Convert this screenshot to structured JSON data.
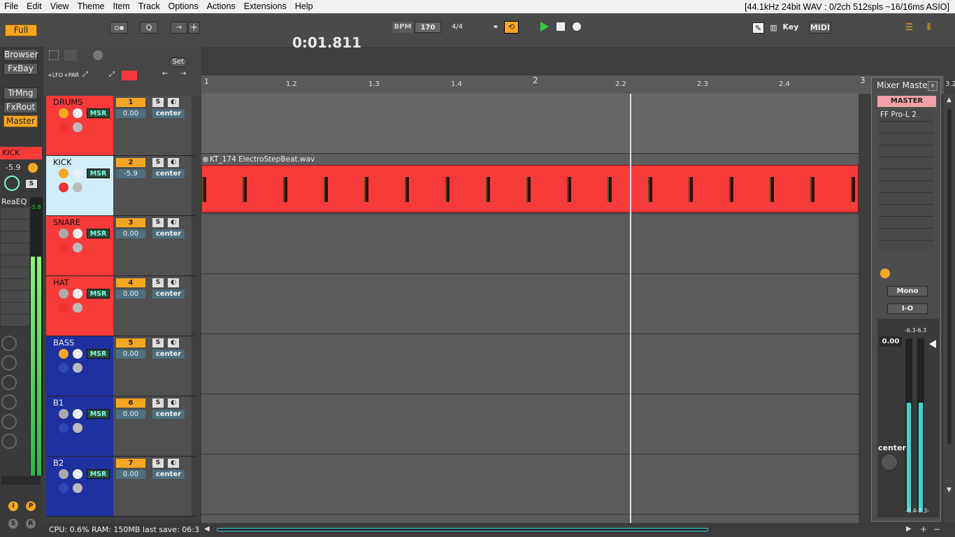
{
  "menu": {
    "items": [
      "File",
      "Edit",
      "View",
      "Theme",
      "Item",
      "Track",
      "Options",
      "Actions",
      "Extensions",
      "Help"
    ],
    "status": "[44.1kHz 24bit WAV : 0/2ch 512spls ~16/16ms ASIO]"
  },
  "toolbar": {
    "full": "Full",
    "quantize": "Q",
    "time": "0:01.811",
    "bpm_label": "BPM",
    "bpm": "170",
    "timesig": "4/4",
    "key": "Key",
    "midi": "MIDI",
    "set": "Set",
    "lfo": "+LFO",
    "par": "+PAR"
  },
  "left": {
    "buttons": [
      "Browser",
      "FxBay",
      "TrMng",
      "FxRout",
      "Master"
    ],
    "selected_track": "KICK",
    "selected_vol": "-5.9",
    "s": "S",
    "fx": "ReaEQ",
    "meter_peak": "-5.8",
    "i": "I",
    "p": "P",
    "s2": "S",
    "r": "R"
  },
  "tracks": [
    {
      "name": "DRUMS",
      "num": "1",
      "vol": "0.00",
      "pan": "center",
      "color": "#f73b3b",
      "folder": true
    },
    {
      "name": "KICK",
      "num": "2",
      "vol": "-5.9",
      "pan": "center",
      "color": "#cfeefa",
      "folder": false,
      "selected": true
    },
    {
      "name": "SNARE",
      "num": "3",
      "vol": "0.00",
      "pan": "center",
      "color": "#f73b3b",
      "folder": false
    },
    {
      "name": "HAT",
      "num": "4",
      "vol": "0.00",
      "pan": "center",
      "color": "#f73b3b",
      "folder": false
    },
    {
      "name": "BASS",
      "num": "5",
      "vol": "0.00",
      "pan": "center",
      "color": "#1e31a0",
      "folder": true
    },
    {
      "name": "B1",
      "num": "6",
      "vol": "0.00",
      "pan": "center",
      "color": "#1e31a0",
      "folder": false
    },
    {
      "name": "B2",
      "num": "7",
      "vol": "0.00",
      "pan": "center",
      "color": "#1e31a0",
      "folder": false
    }
  ],
  "track_labels": {
    "s": "S",
    "msr": "MSR"
  },
  "ruler": [
    "1",
    "1.2",
    "1.3",
    "1.4",
    "2",
    "2.2",
    "2.3",
    "2.4",
    "3",
    "3.2"
  ],
  "clip": {
    "name": "KT_174 ElectroStepBeat.wav"
  },
  "mixer": {
    "title": "Mixer Master",
    "close": "x",
    "master": "MASTER",
    "fx": "FF Pro-L 2",
    "mono": "Mono",
    "io": "I-O",
    "vol": "0.00",
    "peaks": "-6.3-6.3",
    "pan": "center",
    "bottom": "-0.4-0.3-"
  },
  "status": "CPU: 0.6%  RAM: 150MB  last save: 06:3"
}
